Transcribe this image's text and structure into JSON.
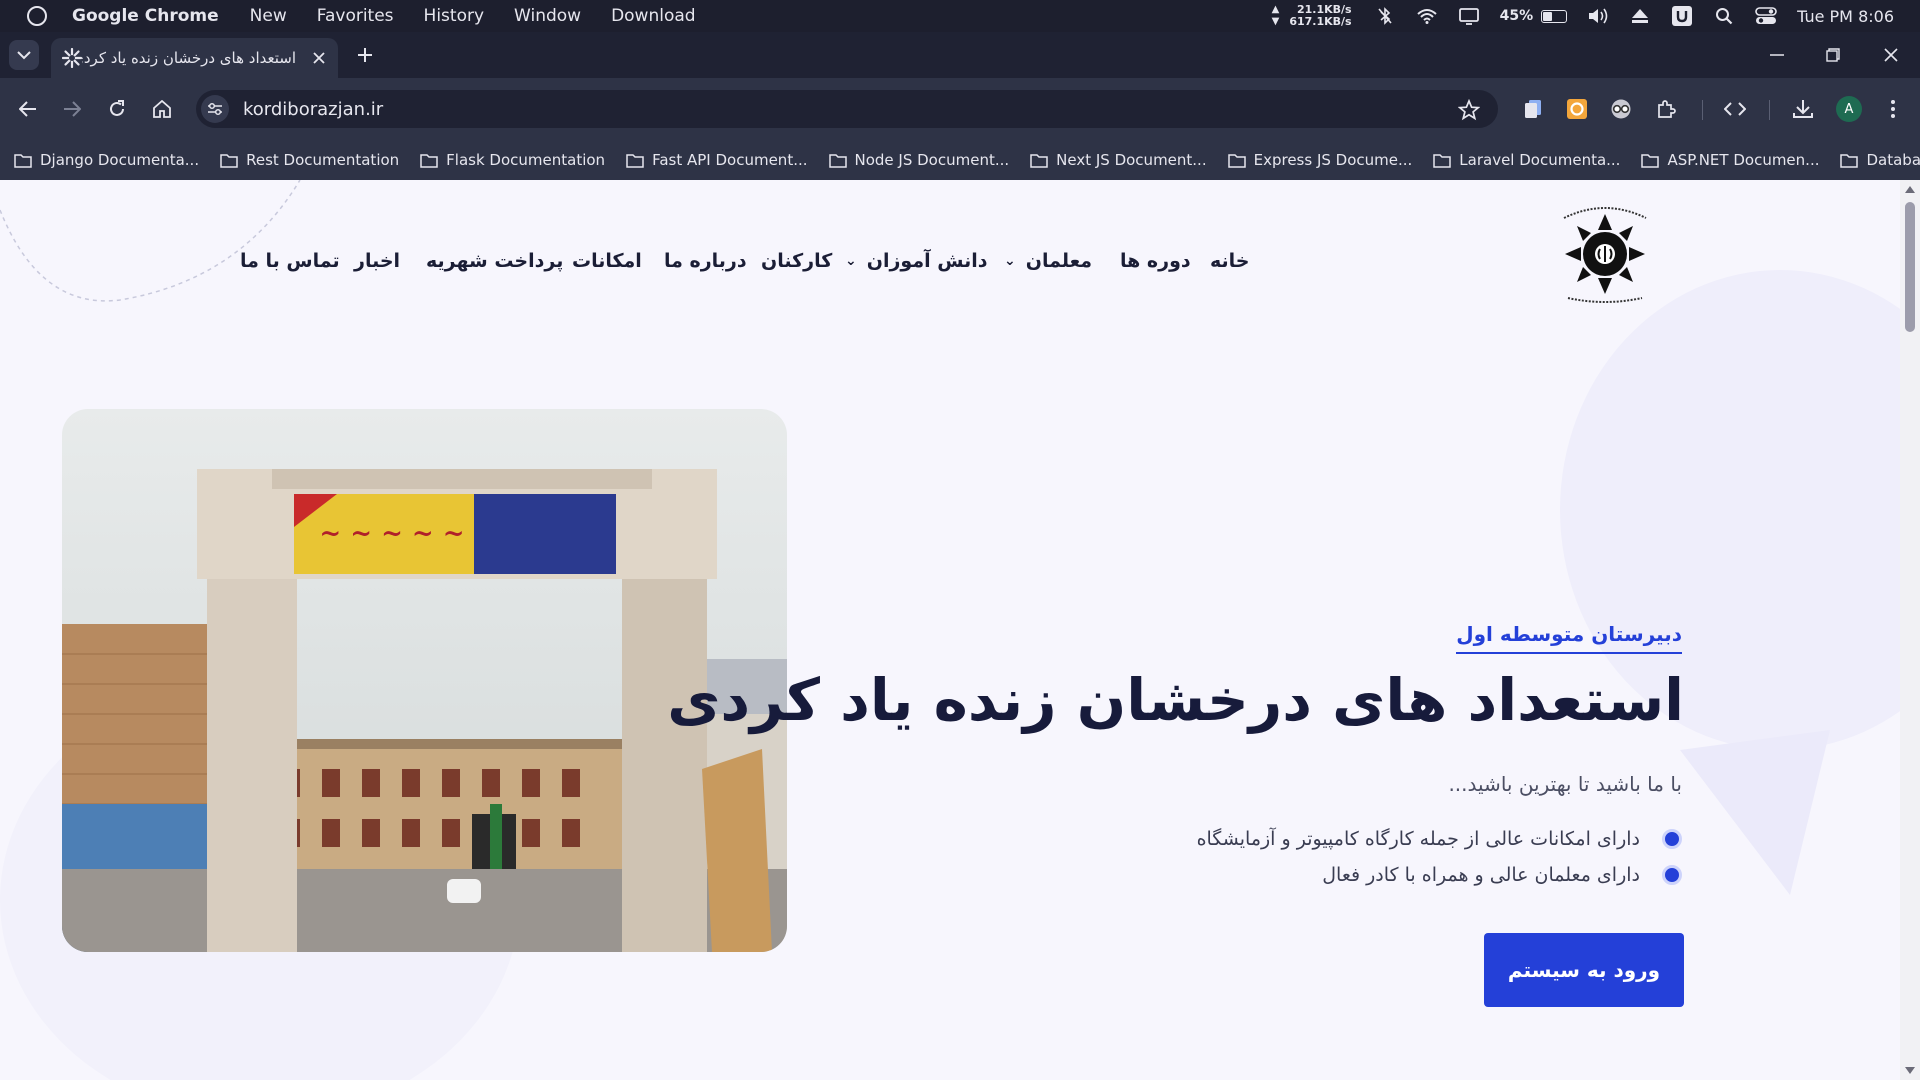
{
  "menubar": {
    "app_name": "Google Chrome",
    "menus": [
      "New",
      "Favorites",
      "History",
      "Window",
      "Download"
    ],
    "net_up": "21.1KB/s",
    "net_down": "617.1KB/s",
    "battery": "45%",
    "battery_level": 0.45,
    "clock": "Tue PM 8:06"
  },
  "browser": {
    "tab_title": "استعداد های درخشان زنده یاد کردی",
    "url": "kordiborazjan.ir",
    "profile_initial": "A",
    "bookmarks": [
      "Django Documenta...",
      "Rest Documentation",
      "Flask Documentation",
      "Fast API Document...",
      "Node JS Document...",
      "Next JS Document...",
      "Express JS Docume...",
      "Laravel Documenta...",
      "ASP.NET Documen...",
      "Database"
    ]
  },
  "site": {
    "nav": {
      "home": "خانه",
      "courses": "دوره ها",
      "teachers": "معلمان",
      "students": "دانش آموزان",
      "staff": "کارکنان",
      "about": "درباره ما",
      "facilities": "امکانات",
      "tuition": "پرداخت شهریه",
      "news": "اخبار",
      "contact": "تماس با ما"
    },
    "hero": {
      "subtitle": "دبیرستان متوسطه اول",
      "title": "استعداد های درخشان زنده یاد کردی",
      "tagline": "با ما باشید تا بهترین باشید...",
      "features": [
        "دارای امکانات عالی از جمله کارگاه کامپیوتر و آزمایشگاه",
        "دارای معلمان عالی و همراه با کادر فعال"
      ],
      "cta": "ورود به سیستم"
    },
    "colors": {
      "primary": "#2440d8",
      "heading": "#171b3b"
    }
  }
}
